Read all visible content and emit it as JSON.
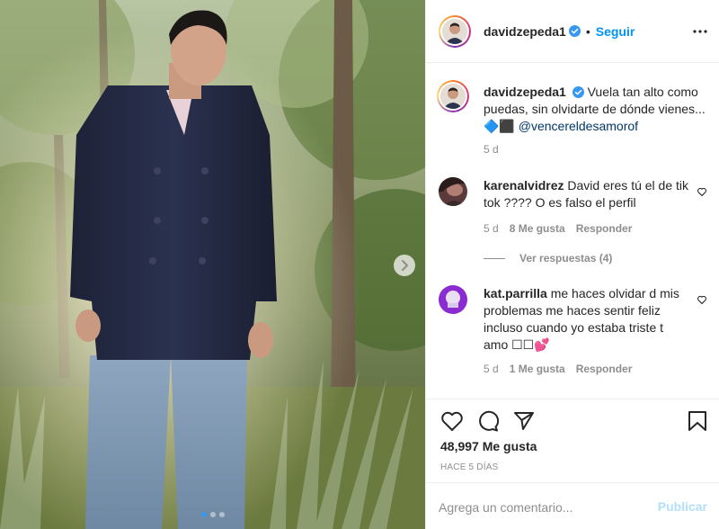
{
  "post": {
    "username": "davidzepeda1",
    "follow_label": "Seguir",
    "separator": "•",
    "more_icon": "more-horizontal-icon",
    "verified_icon": "verified-badge-icon",
    "photo_count": 3,
    "active_photo": 1
  },
  "caption": {
    "username": "davidzepeda1",
    "text": "Vuela tan alto como puedas, sin olvidarte de dónde vienes... 🔷⬛ ",
    "mention": "@vencereldesamorof",
    "time": "5 d"
  },
  "comments": [
    {
      "username": "karenalvidrez",
      "text": "David eres tú el de tik tok ???? O es falso el perfil",
      "time": "5 d",
      "likes": "8 Me gusta",
      "reply_label": "Responder",
      "view_replies": "Ver respuestas (4)"
    },
    {
      "username": "kat.parrilla",
      "text": "me haces olvidar d mis problemas me haces sentir feliz incluso cuando yo estaba triste t amo ☐☐💕",
      "time": "5 d",
      "likes": "1 Me gusta",
      "reply_label": "Responder"
    }
  ],
  "actions": {
    "likes": "48,997 Me gusta",
    "date": "HACE 5 DÍAS",
    "icons": [
      "heart-icon",
      "comment-icon",
      "share-icon",
      "bookmark-icon"
    ]
  },
  "composer": {
    "placeholder": "Agrega un comentario...",
    "publish_label": "Publicar"
  },
  "colors": {
    "link_blue": "#0095f6",
    "mention": "#00376b",
    "muted": "#8e8e8e",
    "publish_disabled": "#b2dffc",
    "carousel_active": "#3897f0"
  }
}
